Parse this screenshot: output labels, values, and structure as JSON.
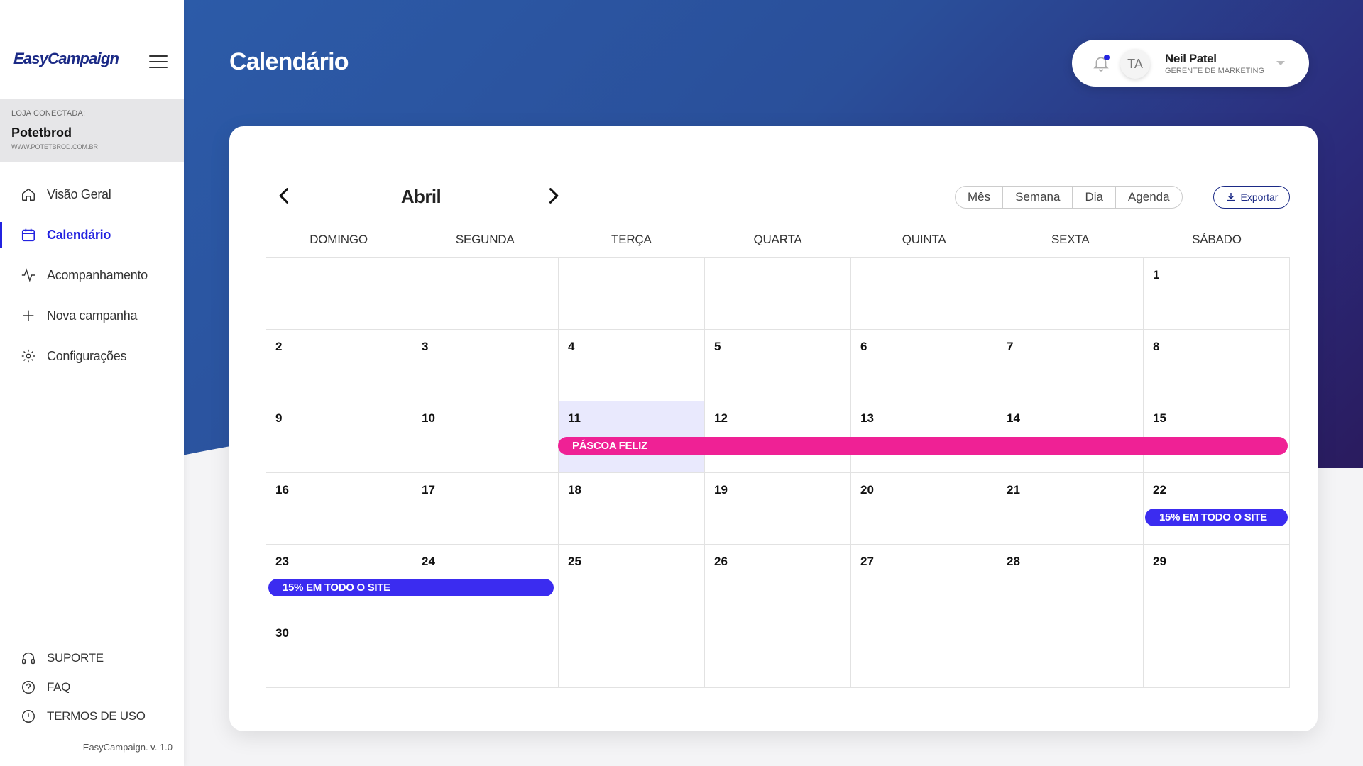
{
  "app": {
    "logo": "EasyCampaign",
    "version": "EasyCampaign. v. 1.0"
  },
  "store": {
    "label": "LOJA CONECTADA:",
    "name": "Potetbrod",
    "url": "WWW.POTETBROD.COM.BR"
  },
  "nav": [
    {
      "label": "Visão Geral",
      "icon": "home-icon"
    },
    {
      "label": "Calendário",
      "icon": "calendar-icon",
      "active": true
    },
    {
      "label": "Acompanhamento",
      "icon": "activity-icon"
    },
    {
      "label": "Nova campanha",
      "icon": "plus-icon"
    },
    {
      "label": "Configurações",
      "icon": "gear-icon"
    }
  ],
  "footer_nav": [
    {
      "label": "SUPORTE",
      "icon": "headset-icon"
    },
    {
      "label": "FAQ",
      "icon": "help-icon"
    },
    {
      "label": "TERMOS DE USO",
      "icon": "alert-icon"
    }
  ],
  "header": {
    "title": "Calendário"
  },
  "user": {
    "initials": "TA",
    "name": "Neil Patel",
    "role": "GERENTE DE MARKETING"
  },
  "calendar": {
    "month": "Abril",
    "views": [
      "Mês",
      "Semana",
      "Dia",
      "Agenda"
    ],
    "export_label": "Exportar",
    "weekdays": [
      "DOMINGO",
      "SEGUNDA",
      "TERÇA",
      "QUARTA",
      "QUINTA",
      "SEXTA",
      "SÁBADO"
    ],
    "days": [
      "",
      "",
      "",
      "",
      "",
      "",
      "1",
      "2",
      "3",
      "4",
      "5",
      "6",
      "7",
      "8",
      "9",
      "10",
      "11",
      "12",
      "13",
      "14",
      "15",
      "16",
      "17",
      "18",
      "19",
      "20",
      "21",
      "22",
      "23",
      "24",
      "25",
      "26",
      "27",
      "28",
      "29",
      "30",
      "",
      "",
      "",
      "",
      "",
      ""
    ],
    "today": "11",
    "events": [
      {
        "label": "PÁSCOA FELIZ",
        "color": "#ef2195"
      },
      {
        "label": "15% EM TODO O SITE",
        "color": "#3b2cf0"
      },
      {
        "label": "15% EM TODO O SITE",
        "color": "#3b2cf0"
      }
    ]
  },
  "colors": {
    "accent": "#2323e0",
    "brand": "#1b2a86",
    "event_pink": "#ef2195",
    "event_blue": "#3b2cf0"
  }
}
